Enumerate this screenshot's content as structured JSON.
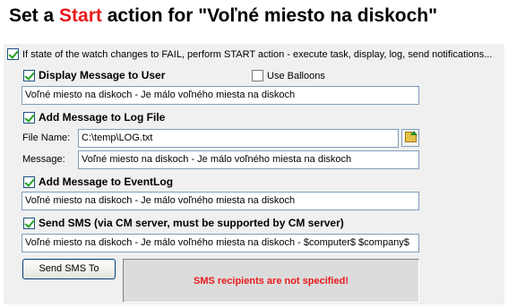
{
  "title": {
    "prefix": "Set a ",
    "accent": "Start",
    "suffix": " action for \"Voľné miesto na diskoch\"",
    "accent_color": "#e8191b"
  },
  "main_checkbox": {
    "checked": true,
    "label": "If state of the watch changes to FAIL, perform START action - execute task, display, log, send notifications..."
  },
  "display_message": {
    "checked": true,
    "label": "Display Message to User",
    "balloons": {
      "checked": false,
      "label": "Use Balloons"
    },
    "value": "Voľné miesto na diskoch - Je málo voľného miesta na diskoch"
  },
  "log_file": {
    "checked": true,
    "label": "Add Message to Log File",
    "file_name_label": "File Name:",
    "file_name_value": "C:\\temp\\LOG.txt",
    "browse_icon": "folder-open-icon",
    "message_label": "Message:",
    "message_value": "Voľné miesto na diskoch - Je málo voľného miesta na diskoch"
  },
  "event_log": {
    "checked": true,
    "label": "Add Message to EventLog",
    "value": "Voľné miesto na diskoch - Je málo voľného miesta na diskoch"
  },
  "sms": {
    "checked": true,
    "label": "Send SMS (via CM server, must be supported by CM server)",
    "value": "Voľné miesto na diskoch - Je málo voľného miesta na diskoch - $computer$ $company$",
    "button_label": "Send SMS To",
    "status": "SMS recipients are not specified!",
    "status_color": "#e8191b"
  }
}
